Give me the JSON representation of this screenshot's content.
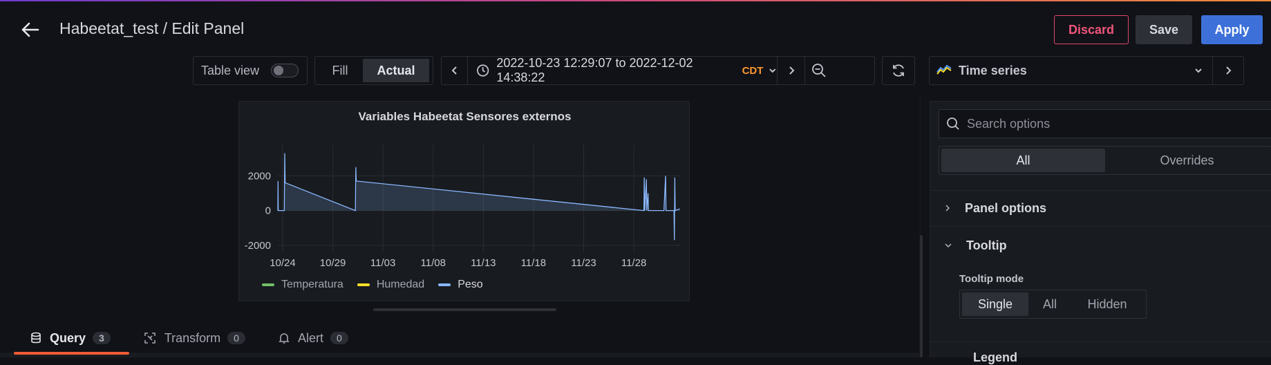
{
  "header": {
    "title": "Habeetat_test / Edit Panel",
    "discard": "Discard",
    "save": "Save",
    "apply": "Apply"
  },
  "toolbar": {
    "table_view_label": "Table view",
    "table_view_on": false,
    "fill_label": "Fill",
    "actual_label": "Actual",
    "time_range": "2022-10-23 12:29:07 to 2022-12-02 14:38:22",
    "timezone": "CDT"
  },
  "viz": {
    "type_label": "Time series"
  },
  "chart_data": {
    "type": "line",
    "title": "Variables Habeetat Sensores externos",
    "x_tick_labels": [
      "10/24",
      "10/29",
      "11/03",
      "11/08",
      "11/13",
      "11/18",
      "11/23",
      "11/28"
    ],
    "y_tick_labels": [
      "2000",
      "0",
      "-2000"
    ],
    "ylim": [
      -2400,
      3800
    ],
    "xlim": [
      "2022-10-23 12:29",
      "2022-12-02 14:38"
    ],
    "grid": true,
    "legend_position": "bottom-left",
    "series": [
      {
        "name": "Temperatura",
        "color": "#73bf69",
        "points": []
      },
      {
        "name": "Humedad",
        "color": "#fade2a",
        "points": []
      },
      {
        "name": "Peso",
        "color": "#8ab8ff",
        "points": [
          [
            "2022-10-23 12:30",
            0
          ],
          [
            "2022-10-23 13:00",
            1700
          ],
          [
            "2022-10-23 13:30",
            0
          ],
          [
            "2022-10-24 04:00",
            0
          ],
          [
            "2022-10-24 05:00",
            3300
          ],
          [
            "2022-10-24 06:00",
            1600
          ],
          [
            "2022-10-31 06:00",
            0
          ],
          [
            "2022-10-31 07:00",
            2500
          ],
          [
            "2022-10-31 08:00",
            1700
          ],
          [
            "2022-11-29 00:00",
            0
          ],
          [
            "2022-11-29 01:00",
            1900
          ],
          [
            "2022-11-29 02:00",
            0
          ],
          [
            "2022-11-29 06:00",
            1800
          ],
          [
            "2022-11-29 07:00",
            0
          ],
          [
            "2022-11-29 10:00",
            1000
          ],
          [
            "2022-11-29 11:00",
            0
          ],
          [
            "2022-12-01 00:00",
            0
          ],
          [
            "2022-12-01 04:00",
            2000
          ],
          [
            "2022-12-01 05:00",
            0
          ],
          [
            "2022-12-02 00:00",
            0
          ],
          [
            "2022-12-02 01:00",
            -1700
          ],
          [
            "2022-12-02 02:00",
            1900
          ],
          [
            "2022-12-02 03:00",
            0
          ],
          [
            "2022-12-02 14:00",
            100
          ]
        ]
      }
    ]
  },
  "tabs": [
    {
      "label": "Query",
      "count": "3"
    },
    {
      "label": "Transform",
      "count": "0"
    },
    {
      "label": "Alert",
      "count": "0"
    }
  ],
  "options": {
    "search_placeholder": "Search options",
    "all_label": "All",
    "overrides_label": "Overrides",
    "sections": {
      "panel_options": "Panel options",
      "tooltip": "Tooltip",
      "legend": "Legend"
    },
    "tooltip_mode_label": "Tooltip mode",
    "tooltip_modes": [
      "Single",
      "All",
      "Hidden"
    ],
    "tooltip_mode_selected": "Single"
  }
}
